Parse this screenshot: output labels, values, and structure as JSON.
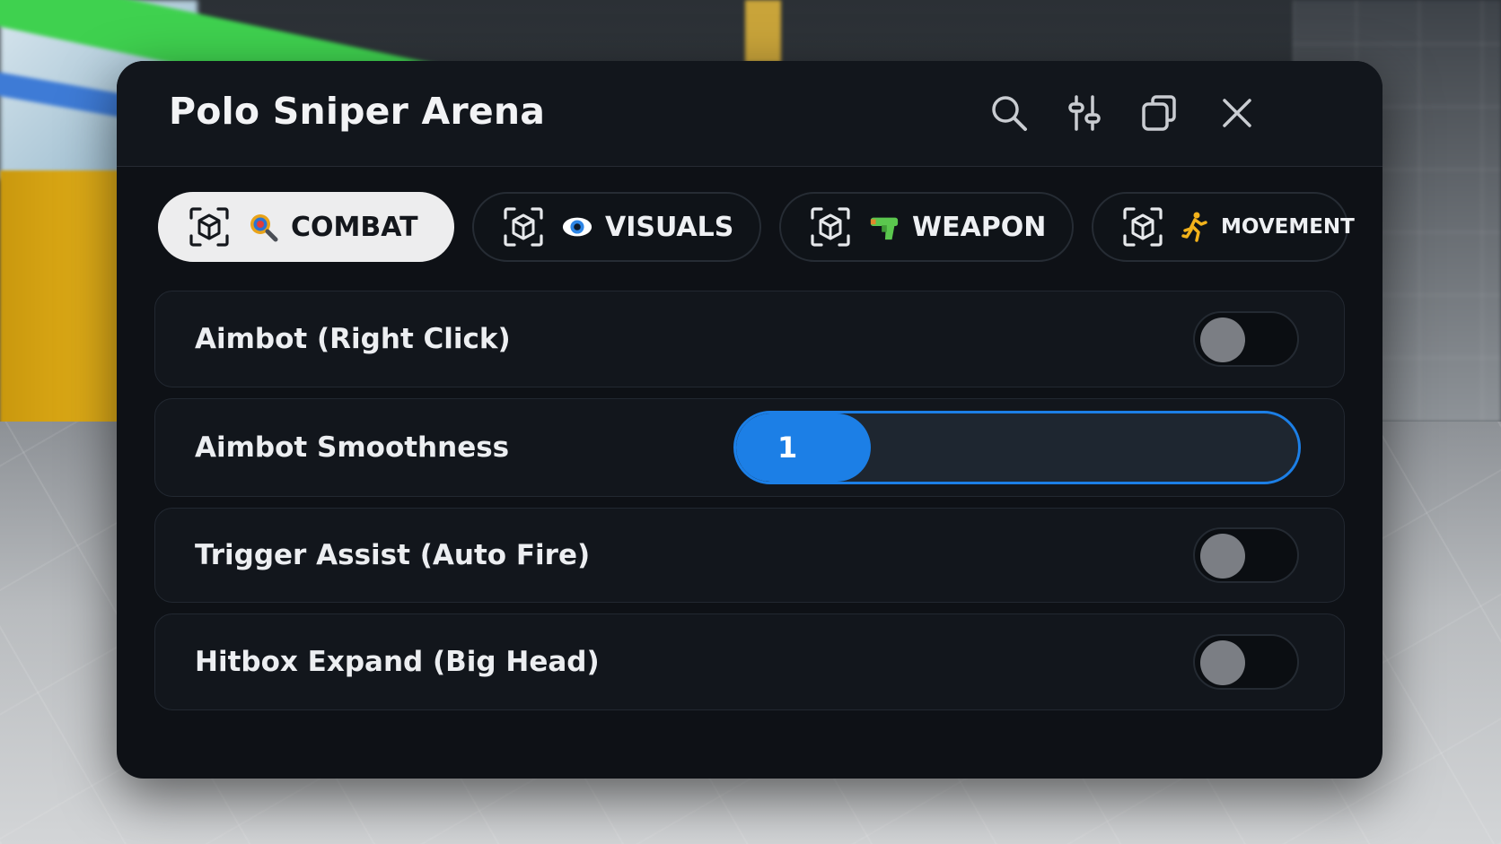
{
  "window": {
    "title": "Polo Sniper Arena"
  },
  "header_icons": [
    {
      "name": "search-icon"
    },
    {
      "name": "sliders-icon"
    },
    {
      "name": "copy-icon"
    },
    {
      "name": "close-icon"
    }
  ],
  "tabs": [
    {
      "label": "COMBAT",
      "icon": "cube-icon",
      "emoji": "target-magnifier-icon",
      "active": true
    },
    {
      "label": "VISUALS",
      "icon": "cube-icon",
      "emoji": "eye-icon",
      "active": false
    },
    {
      "label": "WEAPON",
      "icon": "cube-icon",
      "emoji": "water-pistol-icon",
      "active": false
    },
    {
      "label": "MOVEMENT",
      "icon": "cube-icon",
      "emoji": "running-person-icon",
      "active": false
    }
  ],
  "options": {
    "aimbot": {
      "label": "Aimbot (Right Click)",
      "type": "toggle",
      "enabled": false
    },
    "smoothness": {
      "label": "Aimbot Smoothness",
      "type": "slider",
      "value": "1"
    },
    "trigger": {
      "label": "Trigger Assist (Auto Fire)",
      "type": "toggle",
      "enabled": false
    },
    "hitbox": {
      "label": "Hitbox Expand (Big Head)",
      "type": "toggle",
      "enabled": false
    }
  },
  "colors": {
    "panel_bg": "#0e1116",
    "accent": "#1c7fe6",
    "active_tab_bg": "#ededee",
    "toggle_off_knob": "#7b7e84"
  }
}
